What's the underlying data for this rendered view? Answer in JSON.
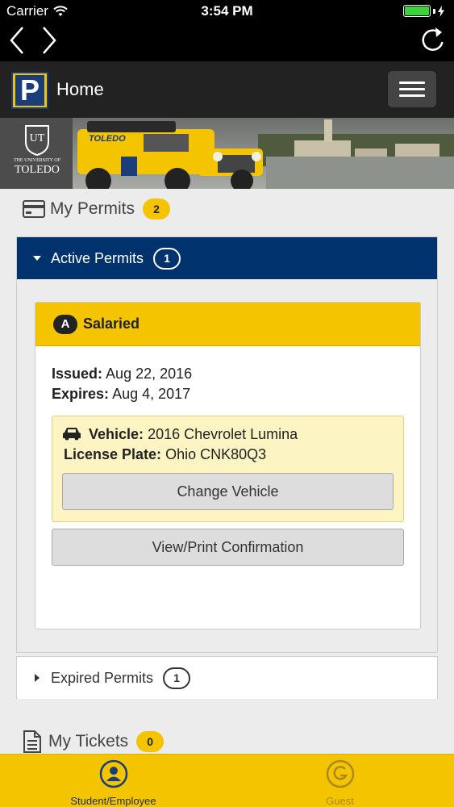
{
  "status_bar": {
    "carrier": "Carrier",
    "time": "3:54 PM"
  },
  "header": {
    "logo_letter": "P",
    "title": "Home"
  },
  "banner": {
    "seal_text": "UT",
    "university_small": "THE UNIVERSITY OF",
    "university_name": "TOLEDO",
    "vehicle_decal": "TOLEDO"
  },
  "my_permits": {
    "title": "My Permits",
    "count": "2"
  },
  "active_permits": {
    "title": "Active Permits",
    "count": "1",
    "permit": {
      "badge": "A",
      "type": "Salaried",
      "issued_label": "Issued:",
      "issued_value": "Aug 22, 2016",
      "expires_label": "Expires:",
      "expires_value": "Aug 4, 2017",
      "vehicle_label": "Vehicle:",
      "vehicle_value": "2016 Chevrolet Lumina",
      "plate_label": "License Plate:",
      "plate_value": "Ohio CNK80Q3",
      "change_vehicle_label": "Change Vehicle",
      "view_print_label": "View/Print Confirmation"
    }
  },
  "expired_permits": {
    "title": "Expired Permits",
    "count": "1"
  },
  "my_tickets": {
    "title": "My Tickets",
    "count": "0"
  },
  "tabs": [
    {
      "label": "Student/Employee",
      "icon": "user-icon",
      "active": true
    },
    {
      "label": "Guest",
      "icon": "guest-g-icon",
      "active": false
    }
  ],
  "colors": {
    "accent_yellow": "#f5c400",
    "navy": "#00326e",
    "header_bg": "#222222"
  }
}
